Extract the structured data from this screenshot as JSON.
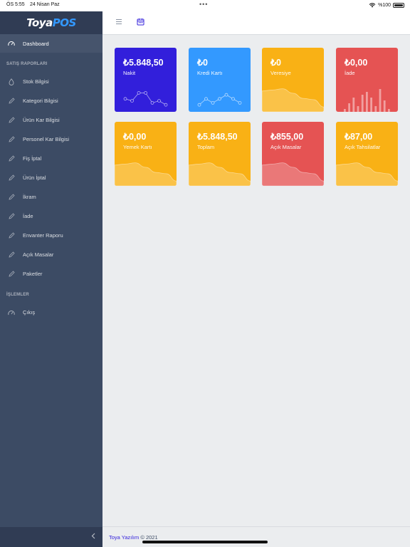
{
  "status_bar": {
    "time": "ÖS 5:55",
    "date": "24 Nisan Paz",
    "battery": "%100"
  },
  "brand": {
    "part1": "Toya",
    "part2": "POS"
  },
  "sidebar": {
    "dashboard": "Dashboard",
    "section_reports": "SATIŞ RAPORLARI",
    "items": [
      {
        "label": "Stok Bilgisi",
        "icon": "drop-icon"
      },
      {
        "label": "Kategori Bilgisi",
        "icon": "pencil-icon"
      },
      {
        "label": "Ürün Kar Bilgisi",
        "icon": "pencil-icon"
      },
      {
        "label": "Personel Kar Bilgisi",
        "icon": "pencil-icon"
      },
      {
        "label": "Fiş İptal",
        "icon": "pencil-icon"
      },
      {
        "label": "Ürün İptal",
        "icon": "pencil-icon"
      },
      {
        "label": "İkram",
        "icon": "pencil-icon"
      },
      {
        "label": "İade",
        "icon": "pencil-icon"
      },
      {
        "label": "Envanter Raporu",
        "icon": "pencil-icon"
      },
      {
        "label": "Açık Masalar",
        "icon": "pencil-icon"
      },
      {
        "label": "Paketler",
        "icon": "pencil-icon"
      }
    ],
    "section_ops": "İŞLEMLER",
    "logout": "Çıkış"
  },
  "cards": [
    {
      "value": "₺5.848,50",
      "label": "Nakit",
      "color": "#321fdb",
      "chart": "line",
      "chart_values": [
        40,
        30,
        70,
        70,
        20,
        30,
        10
      ]
    },
    {
      "value": "₺0",
      "label": "Kredi Kartı",
      "color": "#3399ff",
      "chart": "line",
      "chart_values": [
        10,
        40,
        20,
        40,
        60,
        40,
        20
      ]
    },
    {
      "value": "₺0",
      "label": "Veresiye",
      "color": "#f9b115",
      "chart": "area",
      "chart_values": [
        65,
        68,
        72,
        58,
        42,
        38,
        15
      ]
    },
    {
      "value": "₺0,00",
      "label": "İade",
      "color": "#e55353",
      "chart": "bar",
      "chart_values": [
        10,
        30,
        50,
        20,
        60,
        70,
        50,
        20,
        80,
        40,
        10
      ]
    },
    {
      "value": "₺0,00",
      "label": "Yemek Kartı",
      "color": "#f9b115",
      "chart": "area",
      "chart_values": [
        65,
        68,
        72,
        58,
        42,
        38,
        15
      ]
    },
    {
      "value": "₺5.848,50",
      "label": "Toplam",
      "color": "#f9b115",
      "chart": "area",
      "chart_values": [
        65,
        68,
        72,
        58,
        42,
        38,
        15
      ]
    },
    {
      "value": "₺855,00",
      "label": "Açık Masalar",
      "color": "#e55353",
      "chart": "area",
      "chart_values": [
        65,
        68,
        72,
        58,
        42,
        38,
        15
      ]
    },
    {
      "value": "₺87,00",
      "label": "Açık Tahsilatlar",
      "color": "#f9b115",
      "chart": "area",
      "chart_values": [
        65,
        68,
        72,
        58,
        42,
        38,
        15
      ]
    }
  ],
  "footer": {
    "company": "Toya Yazılım",
    "copyright": "© 2021"
  }
}
